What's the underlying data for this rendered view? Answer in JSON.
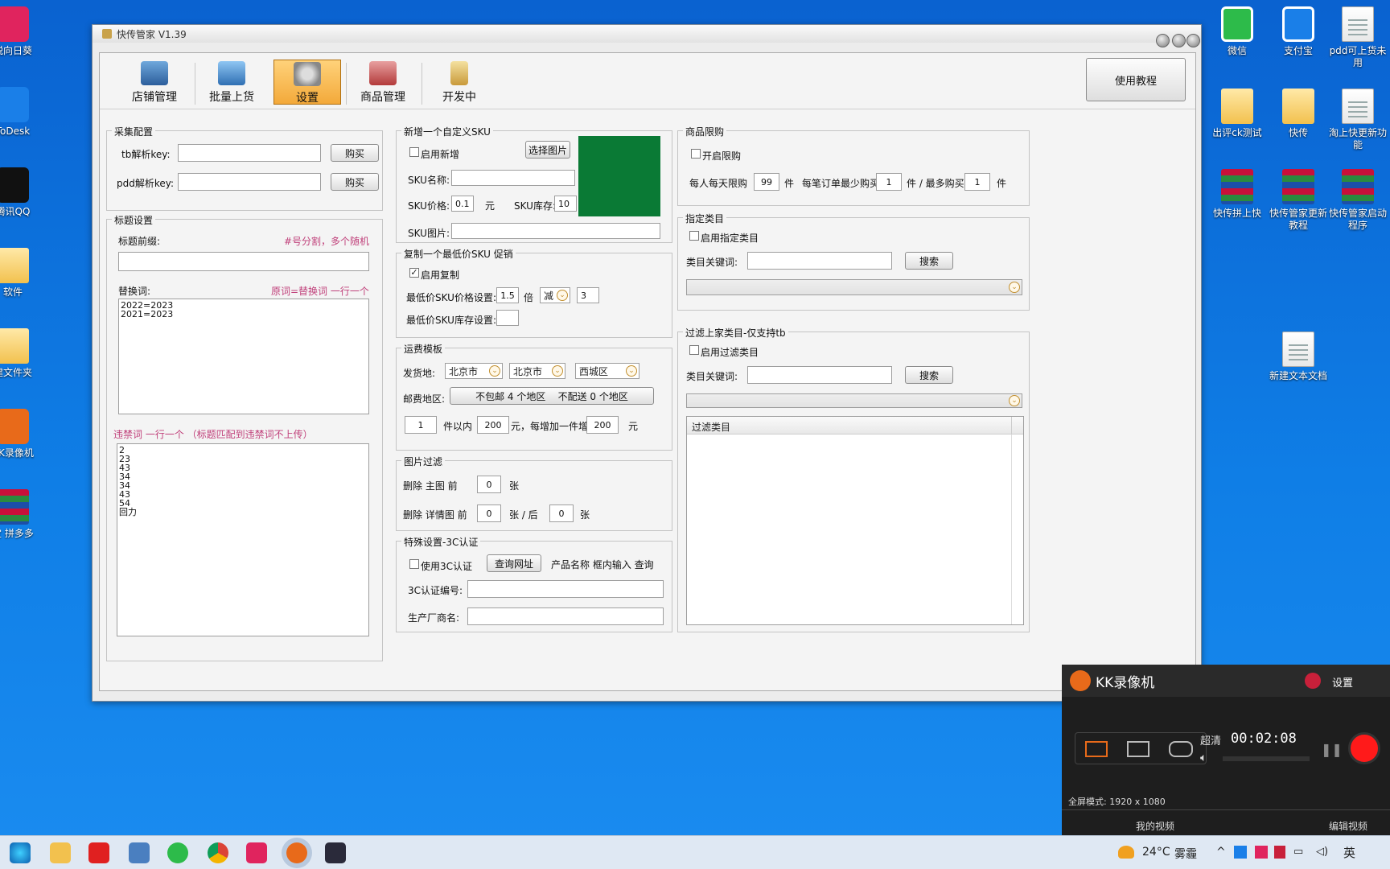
{
  "desktop_left": [
    {
      "label": "锐向日葵",
      "icon": "sunflower-icon",
      "color": "#e0245e"
    },
    {
      "label": "ToDesk",
      "icon": "todesk-icon",
      "color": "#1a7fe8"
    },
    {
      "label": "腾讯QQ",
      "icon": "qq-icon",
      "color": "#111"
    },
    {
      "label": "软件",
      "icon": "folder-icon",
      "color": "#f2c14e"
    },
    {
      "label": "建文件夹",
      "icon": "folder-icon",
      "color": "#f2c14e"
    },
    {
      "label": "KK录像机",
      "icon": "kk-icon",
      "color": "#e86a1a"
    },
    {
      "label": "宝 拼多多",
      "icon": "rar-icon",
      "color": "#c8103a"
    }
  ],
  "desktop_right": [
    {
      "label": "微信",
      "icon": "wechat-qr-icon"
    },
    {
      "label": "支付宝",
      "icon": "alipay-qr-icon"
    },
    {
      "label": "pdd可上货未用",
      "icon": "text-file-icon"
    },
    {
      "label": "出评ck测试",
      "icon": "folder-icon"
    },
    {
      "label": "快传",
      "icon": "folder-icon"
    },
    {
      "label": "淘上快更新功能",
      "icon": "text-file-icon"
    },
    {
      "label": "快传拼上快",
      "icon": "rar-icon"
    },
    {
      "label": "快传管家更新教程",
      "icon": "rar-icon"
    },
    {
      "label": "快传管家启动程序",
      "icon": "rar-icon"
    },
    {
      "label": "新建文本文档",
      "icon": "text-file-icon"
    }
  ],
  "window": {
    "title": "快传管家 V1.39"
  },
  "toolbar": {
    "tabs": [
      "店铺管理",
      "批量上货",
      "设置",
      "商品管理",
      "开发中"
    ],
    "active": "设置",
    "tutorial": "使用教程"
  },
  "collect": {
    "title": "采集配置",
    "tb_label": "tb解析key:",
    "tb_value": "",
    "buy1": "购买",
    "pdd_label": "pdd解析key:",
    "pdd_value": "",
    "buy2": "购买"
  },
  "title_settings": {
    "title": "标题设置",
    "prefix_label": "标题前缀:",
    "prefix_hint": "#号分割，多个随机",
    "prefix_value": "",
    "replace_label": "替换词:",
    "replace_hint": "原词=替换词 一行一个",
    "replace_value": "2022=2023\n2021=2023",
    "banned_label": "违禁词  一行一个 （标题匹配到违禁词不上传）",
    "banned_value": "2\n23\n43\n34\n34\n43\n54\n回力"
  },
  "custom_sku": {
    "title": "新增一个自定义SKU",
    "enable": "启用新增",
    "enabled": false,
    "select_image": "选择图片",
    "name_label": "SKU名称:",
    "name_value": "",
    "price_label": "SKU价格:",
    "price_value": "0.1",
    "yuan": "元",
    "stock_label": "SKU库存:",
    "stock_value": "10",
    "image_label": "SKU图片:",
    "image_value": "",
    "preview_color": "#0a7a35"
  },
  "copy_sku": {
    "title": "复制一个最低价SKU 促销",
    "enable": "启用复制",
    "enabled": true,
    "price_label": "最低价SKU价格设置:",
    "multiplier": "1.5",
    "bei": "倍",
    "op": "减",
    "op_value": "3",
    "stock_label": "最低价SKU库存设置:",
    "stock_value": ""
  },
  "shipping": {
    "title": "运费模板",
    "origin_label": "发货地:",
    "province": "北京市",
    "city": "北京市",
    "district": "西城区",
    "region_label": "邮费地区:",
    "region_button": "不包邮 4 个地区    不配送 0 个地区",
    "qty": "1",
    "qty_text": "件以内",
    "base_price": "200",
    "mid_text": "元，每增加一件增加",
    "add_price": "200",
    "yuan": "元"
  },
  "image_filter": {
    "title": "图片过滤",
    "main_label": "删除 主图 前",
    "main_value": "0",
    "zhang": "张",
    "detail_label": "删除 详情图 前",
    "detail_front": "0",
    "back_text": "张 / 后",
    "detail_back": "0",
    "zhang2": "张"
  },
  "special": {
    "title": "特殊设置-3C认证",
    "enable": "使用3C认证",
    "enabled": false,
    "query_button": "查询网址",
    "hint": "产品名称 框内输入 查询",
    "cert_label": "3C认证编号:",
    "cert_value": "",
    "maker_label": "生产厂商名:",
    "maker_value": ""
  },
  "limit": {
    "title": "商品限购",
    "enable": "开启限购",
    "enabled": false,
    "daily_label": "每人每天限购",
    "daily_value": "99",
    "jian": "件",
    "min_label": "每笔订单最少购买",
    "min_value": "1",
    "max_label": "件 / 最多购买",
    "max_value": "1",
    "jian2": "件"
  },
  "category": {
    "title": "指定类目",
    "enable": "启用指定类目",
    "enabled": false,
    "kw_label": "类目关键词:",
    "kw_value": "",
    "search": "搜索",
    "select_value": ""
  },
  "filter_cat": {
    "title": "过滤上家类目-仅支持tb",
    "enable": "启用过滤类目",
    "enabled": false,
    "kw_label": "类目关键词:",
    "kw_value": "",
    "search": "搜索",
    "select_value": "",
    "table_header": "过滤类目"
  },
  "kk": {
    "name": "KK录像机",
    "settings": "设置",
    "quality": "超清",
    "time": "00:02:08",
    "mode": "全屏模式: 1920 x 1080",
    "my_videos": "我的视频",
    "edit_video": "编辑视频",
    "brand_color": "#e86a1a"
  },
  "taskbar": {
    "weather": "24°C",
    "weather_desc": "雾霾",
    "ime": "英"
  }
}
